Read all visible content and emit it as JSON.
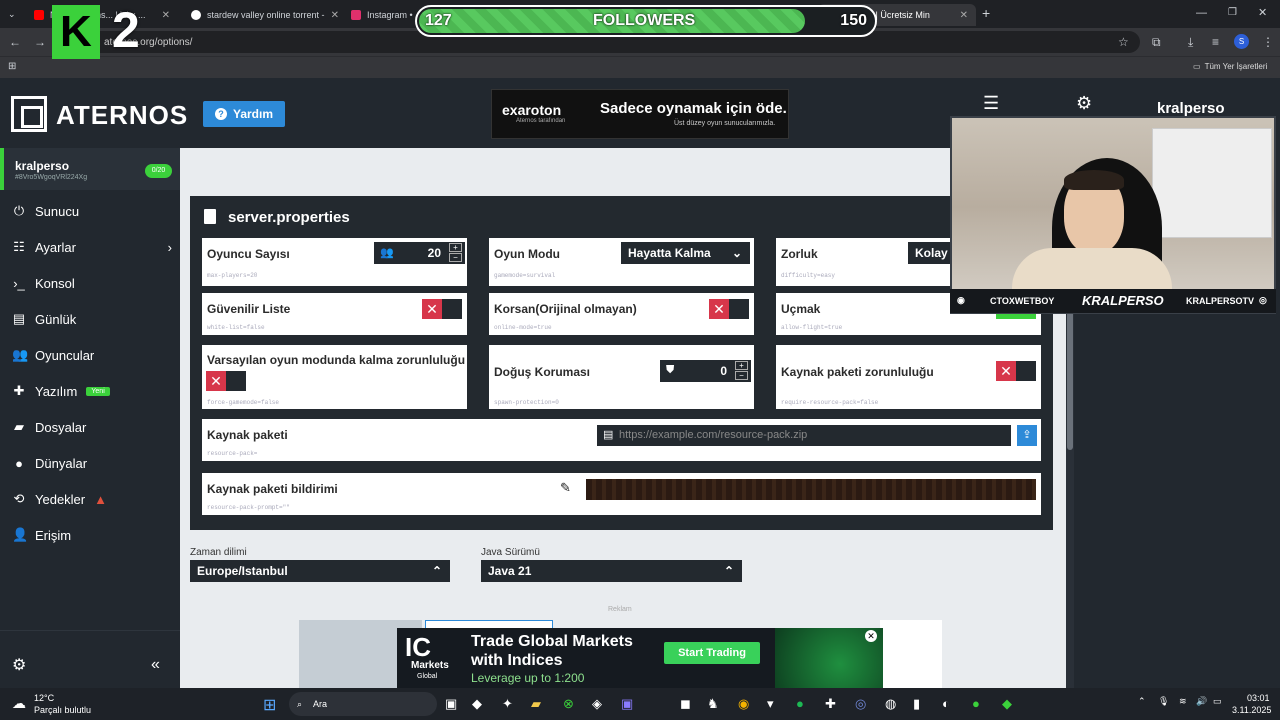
{
  "browser": {
    "tabs": [
      {
        "label": "N... M... Güns... Uzi x ...",
        "color": "#ff0000"
      },
      {
        "label": "stardew valley online torrent - ",
        "color": "#ffffff"
      },
      {
        "label": "Instagram • M",
        "color": "#e1306c"
      },
      {
        "label": "Aternos | Ücretsiz Min",
        "color": "#2d8ad8"
      }
    ],
    "url": "aternos.org/options/",
    "bookmarks_label": "Tüm Yer İşaretleri",
    "profile_initial": "S"
  },
  "overlay": {
    "k2_letter": "K",
    "k2_number": "2",
    "followers_current": "127",
    "followers_label": "FOLLOWERS",
    "followers_goal": "150",
    "followers_progress": 0.85
  },
  "header": {
    "brand": "ATERNOS",
    "help_label": "Yardım",
    "ad_logo": "exaroton",
    "ad_sub": "Aternos tarafından",
    "ad_title": "Sadece oynamak için öde.",
    "ad_text": "Üst düzey oyun sunucularımızla.",
    "username": "kralperso"
  },
  "sidebar": {
    "account_name": "kralperso",
    "account_id": "#8Vro5WgoqVRl224Xg",
    "players_badge": "0/20",
    "items": [
      {
        "label": "Sunucu",
        "icon": "power-icon"
      },
      {
        "label": "Ayarlar",
        "icon": "sliders-icon"
      },
      {
        "label": "Konsol",
        "icon": "terminal-icon"
      },
      {
        "label": "Günlük",
        "icon": "file-icon"
      },
      {
        "label": "Oyuncular",
        "icon": "users-icon"
      },
      {
        "label": "Yazılım",
        "icon": "puzzle-icon"
      },
      {
        "label": "Dosyalar",
        "icon": "folder-icon"
      },
      {
        "label": "Dünyalar",
        "icon": "globe-icon"
      },
      {
        "label": "Yedekler",
        "icon": "archive-icon"
      },
      {
        "label": "Erişim",
        "icon": "user-lock-icon"
      }
    ],
    "new_badge": "Yeni"
  },
  "panel": {
    "title": "server.properties",
    "max_players": {
      "label": "Oyuncu Sayısı",
      "value": "20",
      "key": "max-players=20"
    },
    "gamemode": {
      "label": "Oyun Modu",
      "value": "Hayatta Kalma",
      "key": "gamemode=survival"
    },
    "difficulty": {
      "label": "Zorluk",
      "value": "Kolay",
      "key": "difficulty=easy"
    },
    "whitelist": {
      "label": "Güvenilir Liste",
      "key": "white-list=false"
    },
    "online_mode": {
      "label": "Korsan(Orijinal olmayan)",
      "key": "online-mode=true"
    },
    "flight": {
      "label": "Uçmak",
      "key": "allow-flight=true"
    },
    "force_gamemode": {
      "label": "Varsayılan oyun modunda kalma zorunluluğu",
      "key": "force-gamemode=false"
    },
    "spawn_protection": {
      "label": "Doğuş Koruması",
      "value": "0",
      "key": "spawn-protection=0"
    },
    "require_pack": {
      "label": "Kaynak paketi zorunluluğu",
      "key": "require-resource-pack=false"
    },
    "resource_pack": {
      "label": "Kaynak paketi",
      "placeholder": "https://example.com/resource-pack.zip",
      "key": "resource-pack="
    },
    "pack_prompt": {
      "label": "Kaynak paketi bildirimi",
      "key": "resource-pack-prompt=\"\""
    }
  },
  "settings": {
    "timezone_label": "Zaman dilimi",
    "timezone_value": "Europe/Istanbul",
    "java_label": "Java Sürümü",
    "java_value": "Java 21",
    "ads_label": "Reklam"
  },
  "ad2": {
    "brand_top": "IC",
    "brand_mid": "Markets",
    "brand_bot": "Global",
    "title1": "Trade Global Markets",
    "title2": "with Indices",
    "sub": "Leverage up to 1:200",
    "cta": "Start Trading"
  },
  "webcam": {
    "left_handle": "CTOXWETBOY",
    "center_name": "KRALPERSO",
    "right_handle": "KRALPERSOTV"
  },
  "taskbar": {
    "weather_temp": "12°C",
    "weather_desc": "Parçalı bulutlu",
    "search": "Ara",
    "time": "03:01",
    "date": "3.11.2025"
  },
  "colors": {
    "accent_green": "#3bd13b",
    "help_blue": "#2d8ad8",
    "toggle_red": "#d7364a",
    "panel_dark": "#23292f"
  }
}
